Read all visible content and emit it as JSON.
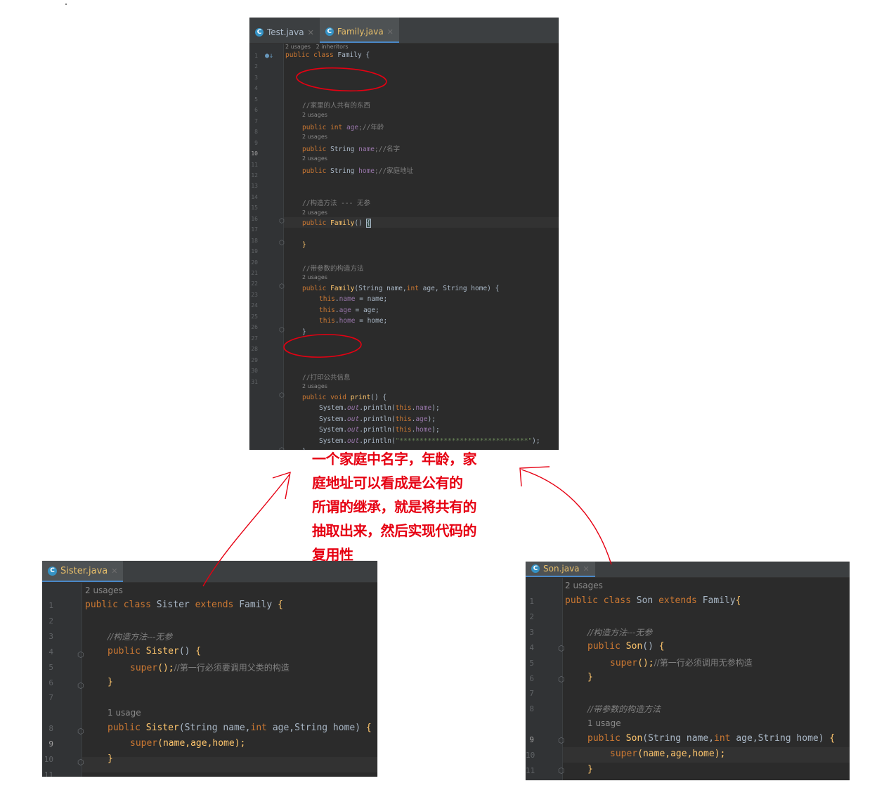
{
  "family_editor": {
    "tabs": [
      {
        "label": "Test.java",
        "active": false
      },
      {
        "label": "Family.java",
        "active": true
      }
    ],
    "hints": {
      "top": "2 usages   2 inheritors",
      "age": "2 usages",
      "name": "2 usages",
      "home": "2 usages",
      "ctor": "2 usages",
      "ctor2": "2 usages",
      "print": "2 usages"
    },
    "lines": {
      "l1": [
        "public",
        "class",
        "Family",
        "{"
      ],
      "l3": "//家里的人共有的东西",
      "l4": [
        "public",
        "int",
        "age",
        ";//年龄"
      ],
      "l5": [
        "public",
        "String",
        "name",
        ";//名字"
      ],
      "l6": [
        "public",
        "String",
        "home",
        ";//家庭地址"
      ],
      "l9": "//构造方法 --- 无参",
      "l10": [
        "public",
        "Family",
        "()",
        "{"
      ],
      "l12": "}",
      "l14": "//带参数的构造方法",
      "l15": [
        "public",
        "Family",
        "(String name,",
        "int",
        "age, String home) {"
      ],
      "l16": [
        "this",
        ".",
        "name",
        " = name;"
      ],
      "l17": [
        "this",
        ".",
        "age",
        " = age;"
      ],
      "l18": [
        "this",
        ".",
        "home",
        " = home;"
      ],
      "l19": "}",
      "l23": "//打印公共信息",
      "l24": [
        "public",
        "void",
        "print",
        "() {"
      ],
      "l25": [
        "System.",
        "out",
        ".println(",
        "this",
        ".",
        "name",
        ");"
      ],
      "l26": [
        "System.",
        "out",
        ".println(",
        "this",
        ".",
        "age",
        ");"
      ],
      "l27": [
        "System.",
        "out",
        ".println(",
        "this",
        ".",
        "home",
        ");"
      ],
      "l28": [
        "System.",
        "out",
        ".println(",
        "\"********************************\"",
        ");"
      ],
      "l29": "}",
      "l31": "}"
    },
    "numbers": [
      "1",
      "2",
      "3",
      "4",
      "5",
      "6",
      "7",
      "8",
      "9",
      "10",
      "11",
      "12",
      "13",
      "14",
      "15",
      "16",
      "17",
      "18",
      "19",
      "20",
      "21",
      "22",
      "23",
      "24",
      "25",
      "26",
      "27",
      "28",
      "29",
      "30",
      "31"
    ]
  },
  "sister_editor": {
    "tab": "Sister.java",
    "hint_top": "2 usages",
    "hint_ctor": "1 usage",
    "lines": {
      "l1": [
        "public",
        "class",
        "Sister",
        "extends",
        "Family",
        "{"
      ],
      "l3": "//构造方法---无参",
      "l4": [
        "public",
        "Sister",
        "()",
        "{"
      ],
      "l5": [
        "super",
        "();",
        "//第一行必须要调用父类的构造"
      ],
      "l6": "}",
      "l8": [
        "public",
        "Sister",
        "(String name,",
        "int",
        "age,String home)",
        "{"
      ],
      "l9": [
        "super",
        "(name,age,home);"
      ],
      "l10": "}"
    },
    "numbers": [
      "1",
      "2",
      "3",
      "4",
      "5",
      "6",
      "7",
      "",
      "8",
      "9",
      "10",
      "11"
    ]
  },
  "son_editor": {
    "tab": "Son.java",
    "hint_top": "2 usages",
    "hint_ctor": "1 usage",
    "lines": {
      "l1": [
        "public",
        "class",
        "Son",
        "extends",
        "Family",
        "{"
      ],
      "l3": "//构造方法---无参",
      "l4": [
        "public",
        "Son",
        "()",
        "{"
      ],
      "l5": [
        "super",
        "();",
        "//第一行必须调用无参构造"
      ],
      "l6": "}",
      "l8": "//带参数的构造方法",
      "l9": [
        "public",
        "Son",
        "(String name,",
        "int",
        "age,String home)",
        "{"
      ],
      "l10": [
        "super",
        "(name,age,home);"
      ],
      "l11": "}"
    },
    "numbers": [
      "1",
      "2",
      "3",
      "4",
      "5",
      "6",
      "7",
      "8",
      "",
      "9",
      "10",
      "11"
    ]
  },
  "annotation": {
    "lines": [
      "一个家庭中名字，年龄，家",
      "庭地址可以看成是公有的",
      "所谓的继承，就是将共有的",
      "抽取出来，然后实现代码的",
      "复用性"
    ]
  },
  "colors": {
    "editor_bg": "#2b2b2b",
    "keyword": "#cc7832",
    "method": "#ffc66d",
    "field": "#9876aa",
    "comment": "#808080",
    "annotation_red": "#e60012"
  }
}
